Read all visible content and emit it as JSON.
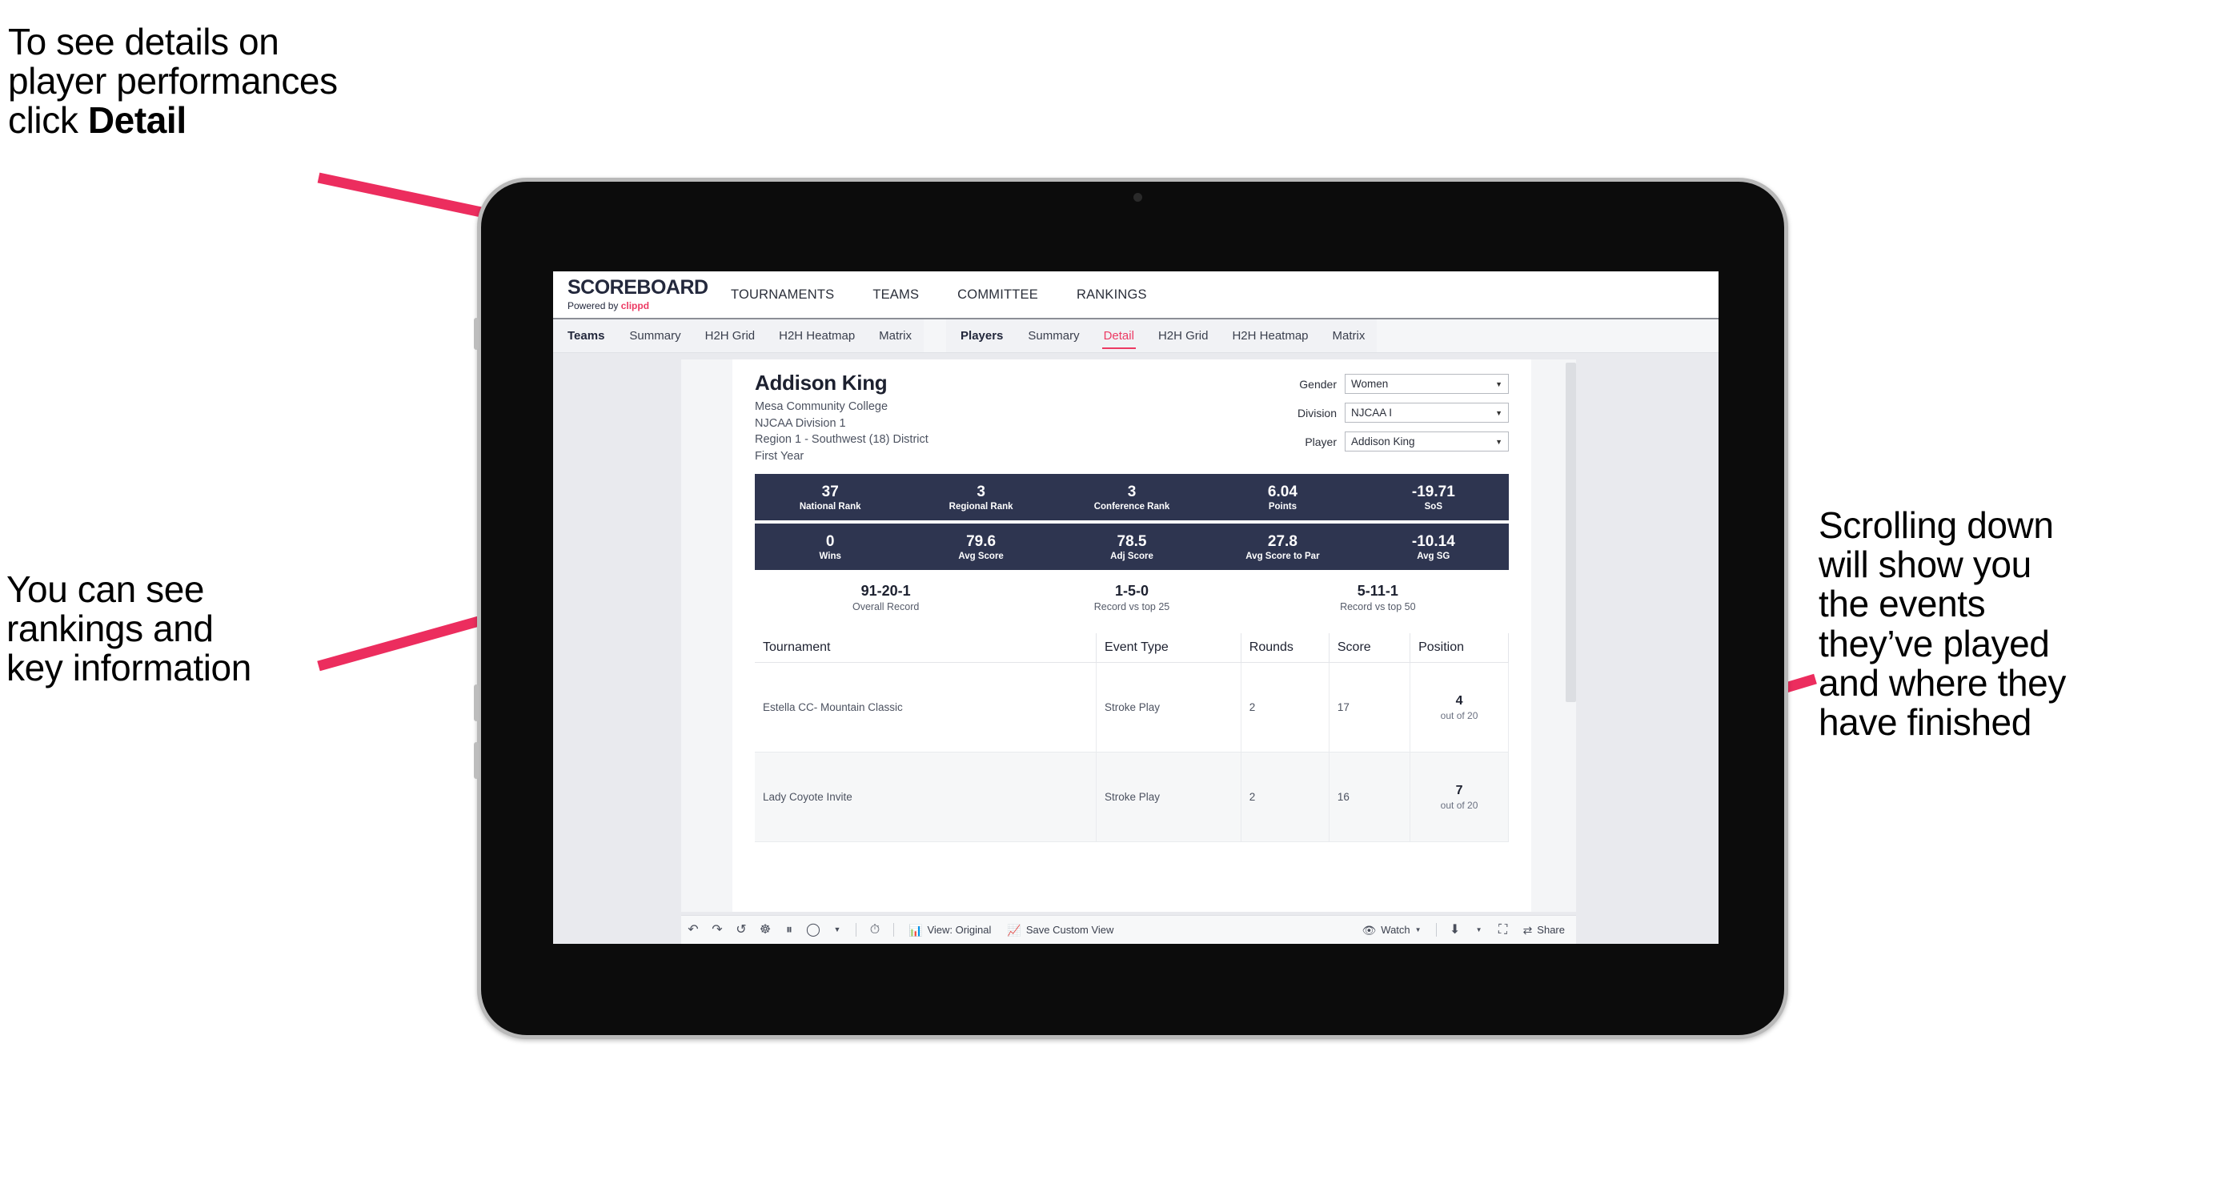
{
  "annotations": {
    "top_left": "To see details on\nplayer performances\nclick ",
    "top_left_bold": "Detail",
    "mid_left": "You can see\nrankings and\nkey information",
    "right": "Scrolling down\nwill show you\nthe events\nthey’ve played\nand where they\nhave finished"
  },
  "colors": {
    "accent_pink": "#ec3a63",
    "navy": "#2e3550",
    "arrow": "#ec2d5e"
  },
  "app": {
    "brand": {
      "name": "SCOREBOARD",
      "tagline_prefix": "Powered by ",
      "tagline_brand": "clippd"
    },
    "top_nav": [
      "TOURNAMENTS",
      "TEAMS",
      "COMMITTEE",
      "RANKINGS"
    ],
    "sub_nav": {
      "group_teams": {
        "lead": "Teams",
        "items": [
          "Summary",
          "H2H Grid",
          "H2H Heatmap",
          "Matrix"
        ]
      },
      "group_players": {
        "lead": "Players",
        "items": [
          "Summary",
          "Detail",
          "H2H Grid",
          "H2H Heatmap",
          "Matrix"
        ],
        "active": "Detail"
      }
    }
  },
  "player": {
    "name": "Addison King",
    "school": "Mesa Community College",
    "division": "NJCAA Division 1",
    "region": "Region 1 - Southwest (18) District",
    "year": "First Year"
  },
  "filters": [
    {
      "label": "Gender",
      "value": "Women"
    },
    {
      "label": "Division",
      "value": "NJCAA I"
    },
    {
      "label": "Player",
      "value": "Addison King"
    }
  ],
  "stats_row1": [
    {
      "value": "37",
      "label": "National Rank"
    },
    {
      "value": "3",
      "label": "Regional Rank"
    },
    {
      "value": "3",
      "label": "Conference Rank"
    },
    {
      "value": "6.04",
      "label": "Points"
    },
    {
      "value": "-19.71",
      "label": "SoS"
    }
  ],
  "stats_row2": [
    {
      "value": "0",
      "label": "Wins"
    },
    {
      "value": "79.6",
      "label": "Avg Score"
    },
    {
      "value": "78.5",
      "label": "Adj Score"
    },
    {
      "value": "27.8",
      "label": "Avg Score to Par"
    },
    {
      "value": "-10.14",
      "label": "Avg SG"
    }
  ],
  "records": [
    {
      "value": "91-20-1",
      "label": "Overall Record"
    },
    {
      "value": "1-5-0",
      "label": "Record vs top 25"
    },
    {
      "value": "5-11-1",
      "label": "Record vs top 50"
    }
  ],
  "events_table": {
    "headers": [
      "Tournament",
      "Event Type",
      "Rounds",
      "Score",
      "Position"
    ],
    "rows": [
      {
        "tournament": "Estella CC- Mountain Classic",
        "event_type": "Stroke Play",
        "rounds": "2",
        "score": "17",
        "position": "4",
        "position_sub": "out of 20"
      },
      {
        "tournament": "Lady Coyote Invite",
        "event_type": "Stroke Play",
        "rounds": "2",
        "score": "16",
        "position": "7",
        "position_sub": "out of 20"
      }
    ]
  },
  "toolbar": {
    "view_label": "View: Original",
    "save_label": "Save Custom View",
    "watch_label": "Watch",
    "share_label": "Share"
  }
}
